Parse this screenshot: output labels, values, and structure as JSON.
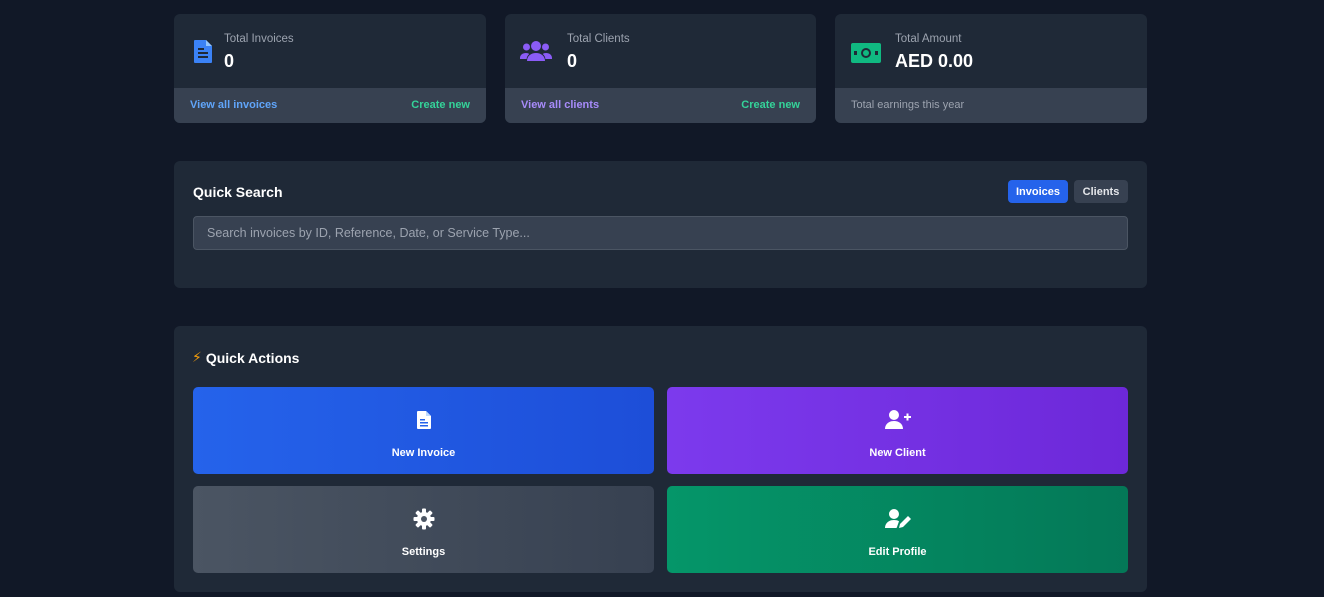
{
  "stats": {
    "invoices": {
      "label": "Total Invoices",
      "value": "0",
      "link_left": "View all invoices",
      "link_right": "Create new",
      "icon": "file-invoice-icon",
      "color": "#3b82f6"
    },
    "clients": {
      "label": "Total Clients",
      "value": "0",
      "link_left": "View all clients",
      "link_right": "Create new",
      "icon": "users-icon",
      "color": "#8b5cf6"
    },
    "amount": {
      "label": "Total Amount",
      "value": "AED 0.00",
      "footer": "Total earnings this year",
      "icon": "money-bill-icon",
      "color": "#10b981"
    }
  },
  "search": {
    "title": "Quick Search",
    "toggle_invoices": "Invoices",
    "toggle_clients": "Clients",
    "placeholder": "Search invoices by ID, Reference, Date, or Service Type..."
  },
  "actions": {
    "title": "Quick Actions",
    "title_icon": "bolt-icon",
    "items": [
      {
        "label": "New Invoice",
        "icon": "file-invoice-icon",
        "color": "#2563eb"
      },
      {
        "label": "New Client",
        "icon": "user-plus-icon",
        "color": "#7c3aed"
      },
      {
        "label": "Settings",
        "icon": "gear-icon",
        "color": "#4b5563"
      },
      {
        "label": "Edit Profile",
        "icon": "user-edit-icon",
        "color": "#059669"
      }
    ]
  }
}
